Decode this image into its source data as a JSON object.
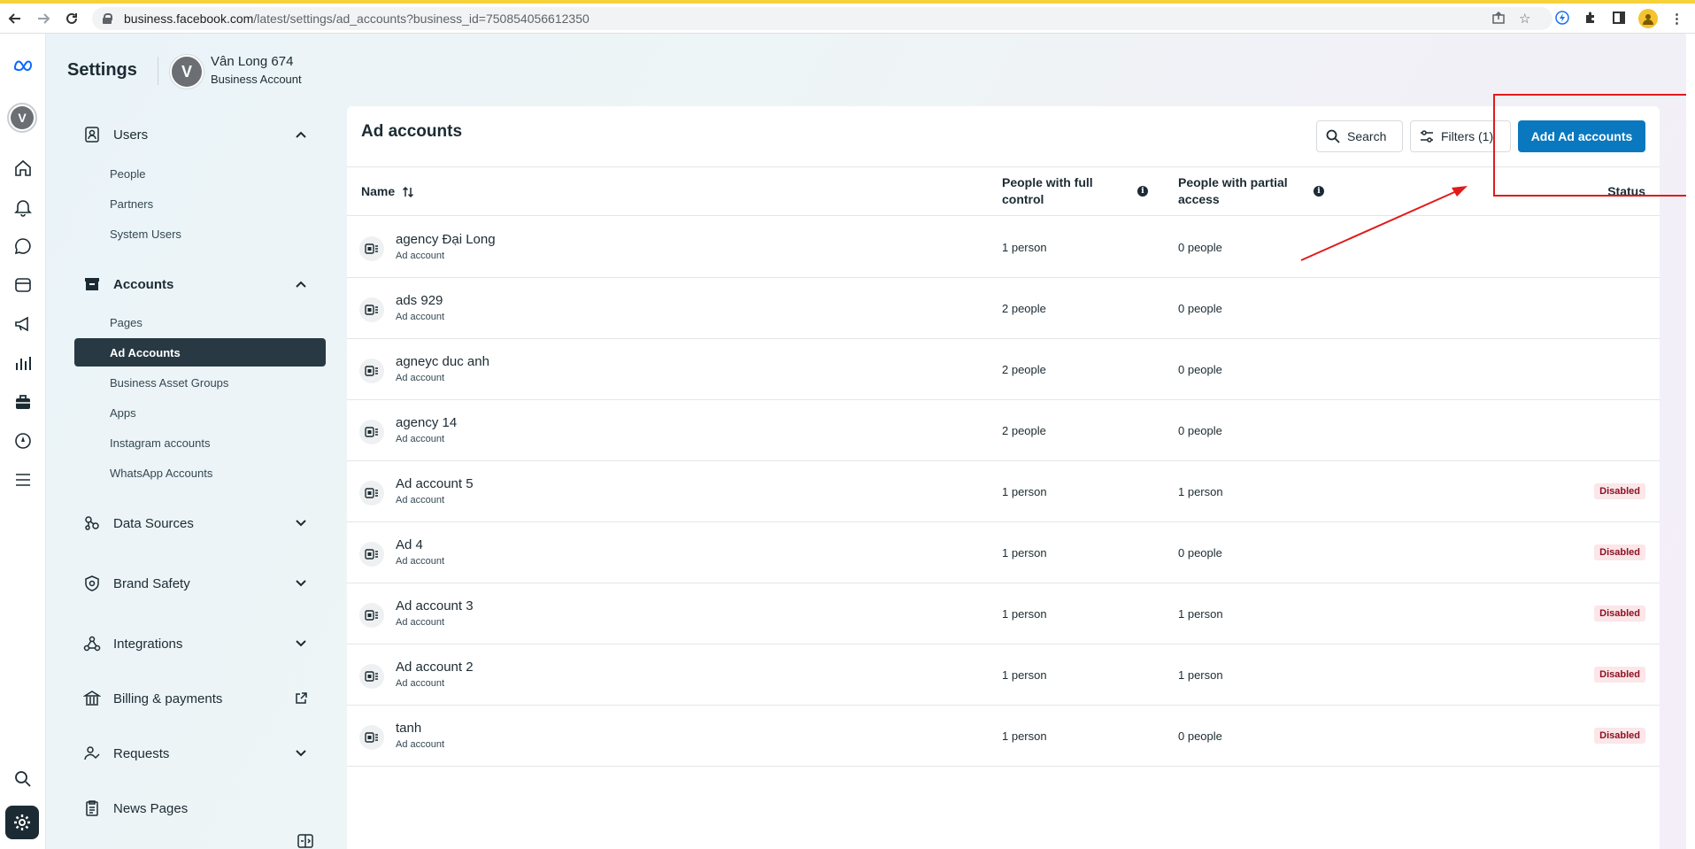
{
  "browser": {
    "url_host": "business.facebook.com",
    "url_path": "/latest/settings/ad_accounts?business_id=750854056612350"
  },
  "header": {
    "title": "Settings",
    "business_name": "Vân Long 674",
    "business_type": "Business Account",
    "avatar_letter": "V"
  },
  "rail": {
    "avatar_letter": "V",
    "icons": [
      "meta-logo-icon",
      "home-icon",
      "bell-icon",
      "chat-icon",
      "layers-icon",
      "megaphone-icon",
      "bar-chart-icon",
      "briefcase-icon",
      "compass-icon",
      "menu-icon",
      "search-icon",
      "gear-icon"
    ]
  },
  "sidebar": {
    "users": {
      "label": "Users",
      "items": [
        "People",
        "Partners",
        "System Users"
      ]
    },
    "accounts": {
      "label": "Accounts",
      "items": [
        "Pages",
        "Ad Accounts",
        "Business Asset Groups",
        "Apps",
        "Instagram accounts",
        "WhatsApp Accounts"
      ]
    },
    "data_sources": "Data Sources",
    "brand_safety": "Brand Safety",
    "integrations": "Integrations",
    "billing": "Billing & payments",
    "requests": "Requests",
    "news_pages": "News Pages"
  },
  "card": {
    "title": "Ad accounts",
    "search_label": "Search",
    "filters_label": "Filters (1)",
    "add_label": "Add Ad accounts",
    "columns": {
      "name": "Name",
      "full_control": "People with full control",
      "partial_access": "People with partial access",
      "status": "Status"
    },
    "rows": [
      {
        "name": "agency Đại Long",
        "sub": "Ad account",
        "full": "1 person",
        "partial": "0 people",
        "status": ""
      },
      {
        "name": "ads 929",
        "sub": "Ad account",
        "full": "2 people",
        "partial": "0 people",
        "status": ""
      },
      {
        "name": "agneyc duc anh",
        "sub": "Ad account",
        "full": "2 people",
        "partial": "0 people",
        "status": ""
      },
      {
        "name": "agency 14",
        "sub": "Ad account",
        "full": "2 people",
        "partial": "0 people",
        "status": ""
      },
      {
        "name": "Ad account 5",
        "sub": "Ad account",
        "full": "1 person",
        "partial": "1 person",
        "status": "Disabled"
      },
      {
        "name": "Ad 4",
        "sub": "Ad account",
        "full": "1 person",
        "partial": "0 people",
        "status": "Disabled"
      },
      {
        "name": "Ad account 3",
        "sub": "Ad account",
        "full": "1 person",
        "partial": "1 person",
        "status": "Disabled"
      },
      {
        "name": "Ad account 2",
        "sub": "Ad account",
        "full": "1 person",
        "partial": "1 person",
        "status": "Disabled"
      },
      {
        "name": "tanh",
        "sub": "Ad account",
        "full": "1 person",
        "partial": "0 people",
        "status": "Disabled"
      }
    ]
  },
  "colors": {
    "accent": "#0a78be",
    "active_nav": "#283943",
    "disabled_badge_bg": "#fbe6e8",
    "disabled_badge_text": "#8c1125",
    "annotation": "#e01b1b"
  }
}
